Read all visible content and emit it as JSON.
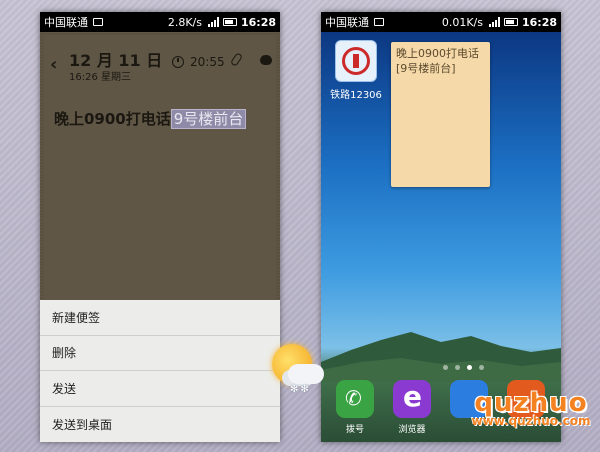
{
  "left_phone": {
    "status": {
      "carrier": "中国联通",
      "speed": "2.8K/s",
      "time": "16:28"
    },
    "note": {
      "date": "12 月 11 日",
      "subtitle": "16:26 星期三",
      "alarm_time": "20:55",
      "text_main": "晚上0900打电话",
      "text_selected": "9号楼前台"
    },
    "menu": [
      {
        "label": "新建便签"
      },
      {
        "label": "删除"
      },
      {
        "label": "发送"
      },
      {
        "label": "发送到桌面"
      }
    ]
  },
  "right_phone": {
    "status": {
      "carrier": "中国联通",
      "speed": "0.01K/s",
      "time": "16:28"
    },
    "app_12306_label": "铁路12306",
    "widget_text": "晚上0900打电话[9号楼前台]",
    "dock": [
      {
        "label": "拨号",
        "icon": "phone-icon",
        "color": "#3aa343"
      },
      {
        "label": "浏览器",
        "icon": "browser-icon",
        "color": "#8a3ad1"
      }
    ]
  },
  "watermark": {
    "brand": "quzhuo",
    "url": "www.quzhuo.com"
  }
}
